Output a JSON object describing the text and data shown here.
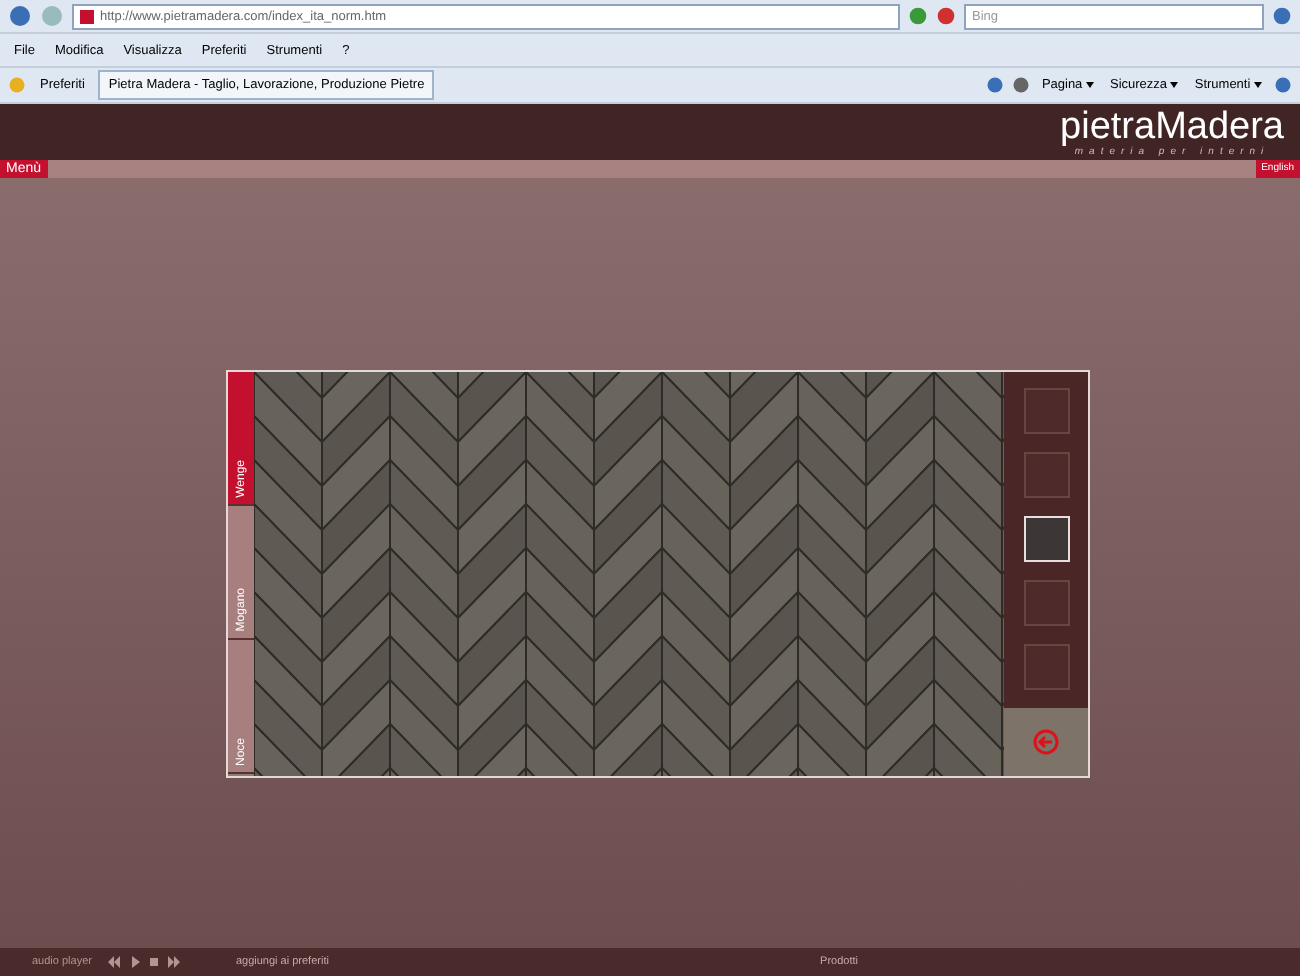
{
  "browser": {
    "url": "http://www.pietramadera.com/index_ita_norm.htm",
    "search": {
      "placeholder": "Bing"
    },
    "menu": [
      "File",
      "Modifica",
      "Visualizza",
      "Preferiti",
      "Strumenti",
      "?"
    ],
    "favorites": "Preferiti",
    "tab": {
      "title": "Pietra Madera - Taglio, Lavorazione, Produzione Pietre"
    },
    "commands": [
      "Pagina",
      "Sicurezza",
      "Strumenti"
    ]
  },
  "header": {
    "logo": "pietraMadera",
    "tagline": "materia per interni",
    "menu_button": "Menù",
    "language": "English"
  },
  "viewer": {
    "woods": [
      {
        "label": "Wenge",
        "selected": true
      },
      {
        "label": "Mogano",
        "selected": false
      },
      {
        "label": "Noce",
        "selected": false
      }
    ],
    "patterns": [
      {
        "selected": false
      },
      {
        "selected": false
      },
      {
        "selected": true
      },
      {
        "selected": false
      },
      {
        "selected": false
      }
    ]
  },
  "footer": {
    "audio_label": "audio player",
    "favorites_link": "aggiungi ai preferiti",
    "products_link": "Prodotti"
  }
}
